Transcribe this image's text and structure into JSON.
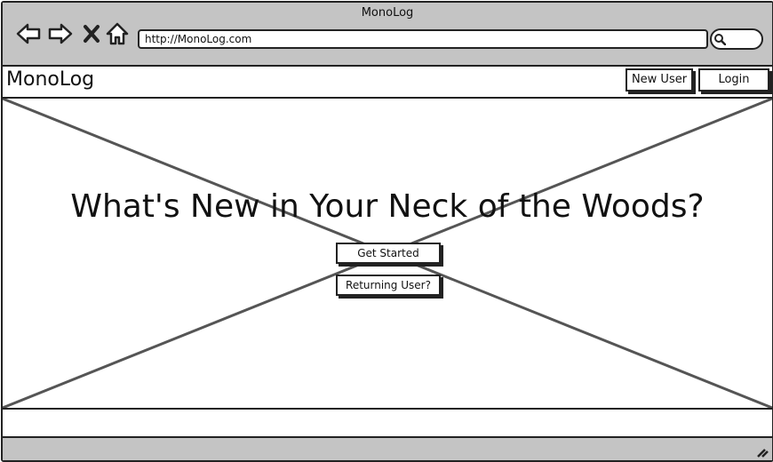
{
  "window": {
    "title": "MonoLog"
  },
  "browser": {
    "url": "http://MonoLog.com",
    "icons": [
      "back-arrow-icon",
      "forward-arrow-icon",
      "close-x-icon",
      "home-icon",
      "search-icon"
    ]
  },
  "app": {
    "brand": "MonoLog",
    "header_buttons": {
      "new_user": "New User",
      "login": "Login"
    }
  },
  "hero": {
    "headline": "What's New in Your Neck of the Woods?",
    "get_started": "Get Started",
    "returning_user": "Returning User?"
  }
}
